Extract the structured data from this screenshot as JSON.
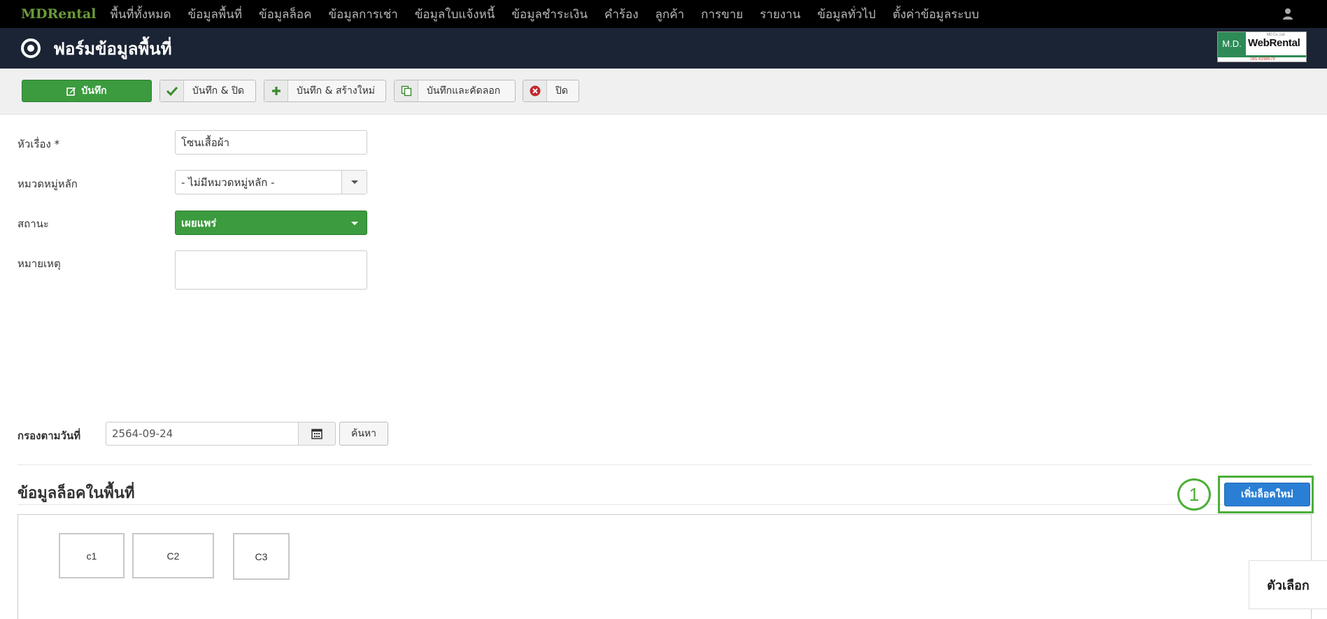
{
  "navbar": {
    "brand": "MDRental",
    "items": [
      "พื้นที่ทั้งหมด",
      "ข้อมูลพื้นที่",
      "ข้อมูลล็อค",
      "ข้อมูลการเช่า",
      "ข้อมูลใบแจ้งหนี้",
      "ข้อมูลชำระเงิน",
      "คำร้อง",
      "ลูกค้า",
      "การขาย",
      "รายงาน",
      "ข้อมูลทั่วไป",
      "ตั้งค่าข้อมูลระบบ"
    ],
    "user_icon": "user-icon"
  },
  "header": {
    "title": "ฟอร์มข้อมูลพื้นที่",
    "logo": {
      "md": "M.D.",
      "brand": "WebRental",
      "tagline": "MD Co.,Ltd.",
      "phone": "081-6198579"
    }
  },
  "toolbar": {
    "save": "บันทึก",
    "save_close": "บันทึก & ปิด",
    "save_new": "บันทึก & สร้างใหม่",
    "save_copy": "บันทึกและคัดลอก",
    "close": "ปิด"
  },
  "form": {
    "title_label": "หัวเรื่อง *",
    "title_value": "โซนเสื้อผ้า",
    "category_label": "หมวดหมู่หลัก",
    "category_value": "- ไม่มีหมวดหมู่หลัก -",
    "status_label": "สถานะ",
    "status_value": "เผยแพร่",
    "note_label": "หมายเหตุ",
    "note_value": ""
  },
  "filter": {
    "label": "กรองตามวันที่",
    "date": "2564-09-24",
    "search": "ค้นหา"
  },
  "locks": {
    "section_title": "ข้อมูลล็อคในพื้นที่",
    "add_button": "เพิ่มล็อคใหม่",
    "step_badge": "1",
    "items": [
      "c1",
      "C2",
      "C3"
    ]
  },
  "options_button": "ตัวเลือก",
  "colors": {
    "save_green": "#3b9b3e",
    "add_blue": "#2a7fd4",
    "highlight_green": "#4caf38",
    "header_bg": "#1b2434"
  }
}
